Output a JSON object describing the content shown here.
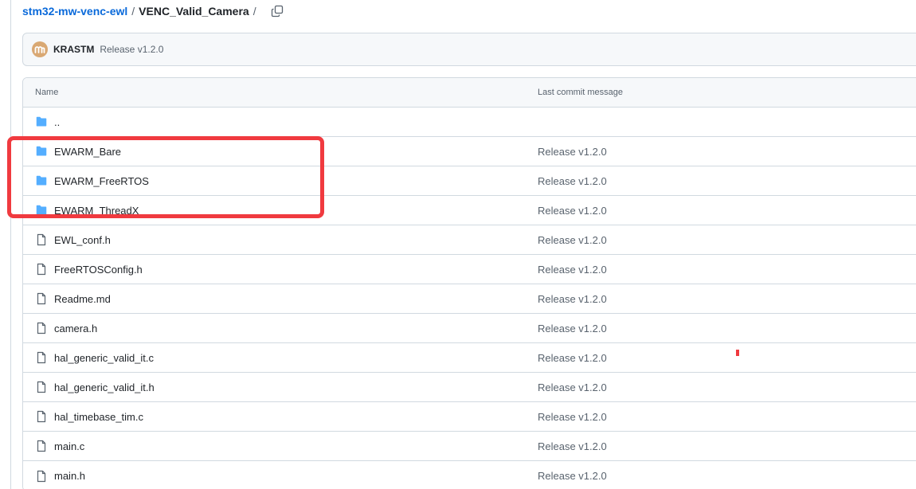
{
  "breadcrumb": {
    "repo": "stm32-mw-venc-ewl",
    "separator": "/",
    "directory": "VENC_Valid_Camera",
    "trailing_separator": "/",
    "copy_icon": "copy-icon"
  },
  "latest_commit": {
    "author": "KRASTM",
    "message": "Release v1.2.0",
    "avatar_color": "#d9a873"
  },
  "table": {
    "headers": {
      "name": "Name",
      "message": "Last commit message"
    },
    "rows": [
      {
        "name": "..",
        "type": "folder",
        "message": ""
      },
      {
        "name": "EWARM_Bare",
        "type": "folder",
        "message": "Release v1.2.0"
      },
      {
        "name": "EWARM_FreeRTOS",
        "type": "folder",
        "message": "Release v1.2.0"
      },
      {
        "name": "EWARM_ThreadX",
        "type": "folder",
        "message": "Release v1.2.0"
      },
      {
        "name": "EWL_conf.h",
        "type": "file",
        "message": "Release v1.2.0"
      },
      {
        "name": "FreeRTOSConfig.h",
        "type": "file",
        "message": "Release v1.2.0"
      },
      {
        "name": "Readme.md",
        "type": "file",
        "message": "Release v1.2.0"
      },
      {
        "name": "camera.h",
        "type": "file",
        "message": "Release v1.2.0"
      },
      {
        "name": "hal_generic_valid_it.c",
        "type": "file",
        "message": "Release v1.2.0"
      },
      {
        "name": "hal_generic_valid_it.h",
        "type": "file",
        "message": "Release v1.2.0"
      },
      {
        "name": "hal_timebase_tim.c",
        "type": "file",
        "message": "Release v1.2.0"
      },
      {
        "name": "main.c",
        "type": "file",
        "message": "Release v1.2.0"
      },
      {
        "name": "main.h",
        "type": "file",
        "message": "Release v1.2.0"
      }
    ]
  },
  "colors": {
    "link": "#0969da",
    "folder_icon": "#54aeff",
    "annotation": "#f03a3f",
    "border": "#d1d9e0"
  }
}
